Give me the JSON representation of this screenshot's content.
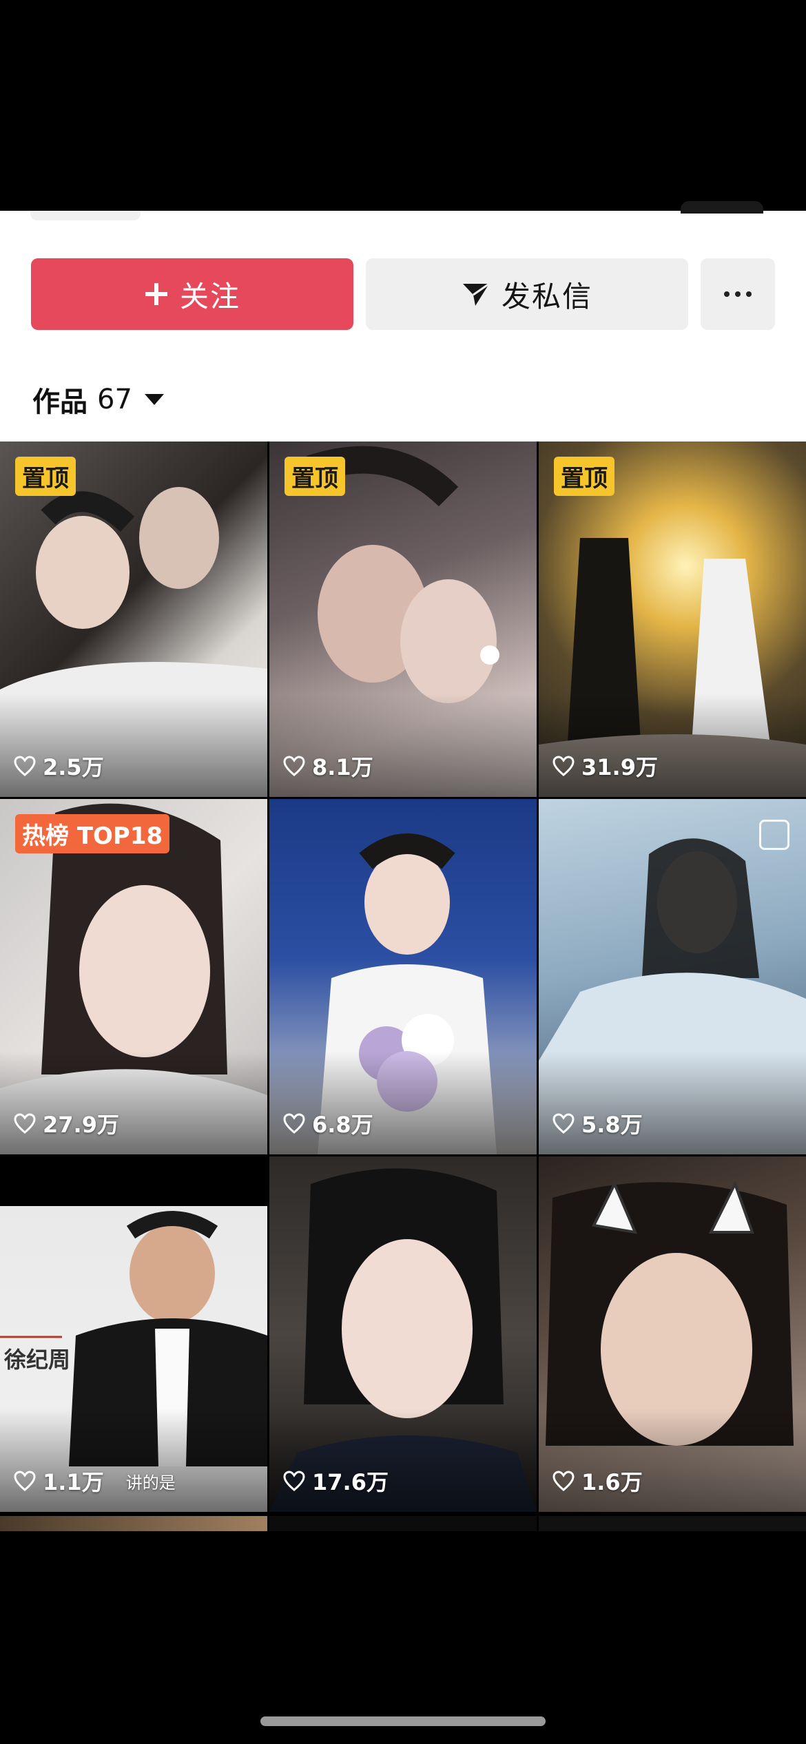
{
  "actions": {
    "follow_label": "关注",
    "message_label": "发私信",
    "more_label": "more"
  },
  "works": {
    "label": "作品",
    "count": "67"
  },
  "grid": [
    {
      "badge": "置顶",
      "badge_type": "pinned",
      "likes": "2.5万"
    },
    {
      "badge": "置顶",
      "badge_type": "pinned",
      "likes": "8.1万"
    },
    {
      "badge": "置顶",
      "badge_type": "pinned",
      "likes": "31.9万"
    },
    {
      "badge": "热榜 TOP18",
      "badge_type": "hot",
      "likes": "27.9万"
    },
    {
      "badge": "",
      "badge_type": "none",
      "likes": "6.8万"
    },
    {
      "badge": "",
      "badge_type": "none",
      "likes": "5.8万"
    },
    {
      "badge": "",
      "badge_type": "none",
      "likes": "1.1万",
      "extra": "讲的是",
      "caption": "徐纪周"
    },
    {
      "badge": "",
      "badge_type": "none",
      "likes": "17.6万"
    },
    {
      "badge": "",
      "badge_type": "none",
      "likes": "1.6万"
    }
  ],
  "colors": {
    "follow": "#e5495b",
    "secondary_button": "#efefef",
    "pinned_badge": "#f6c42b",
    "hot_badge": "#f2683c"
  },
  "icons": {
    "follow": "plus-icon",
    "message": "send-icon",
    "more": "more-dots-icon",
    "likes": "heart-icon",
    "sort": "caret-down-icon"
  }
}
